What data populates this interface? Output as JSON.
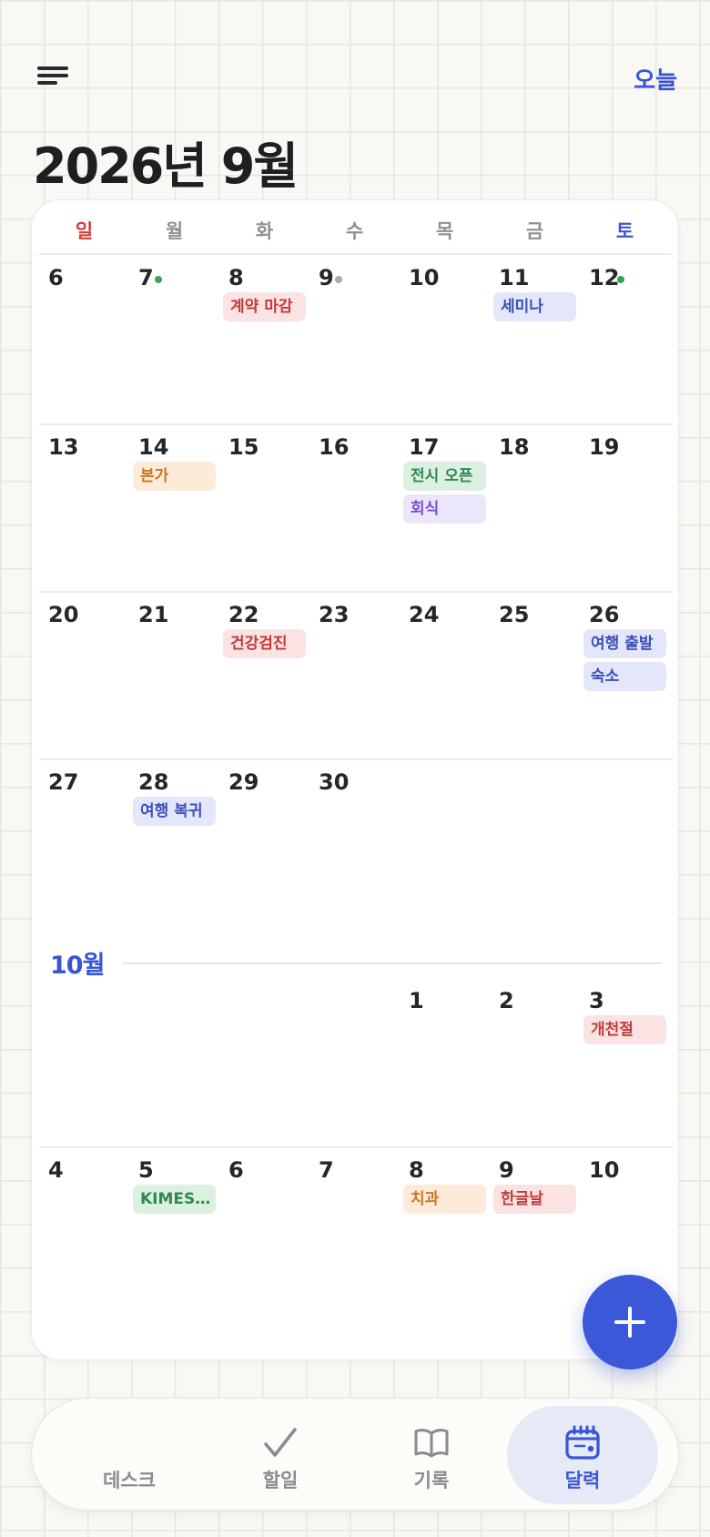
{
  "header": {
    "today_label": "오늘",
    "title": "2026년 9월"
  },
  "weekdays": [
    "일",
    "월",
    "화",
    "수",
    "목",
    "금",
    "토"
  ],
  "september": {
    "weeks": [
      [
        {
          "d": "6"
        },
        {
          "d": "7"
        },
        {
          "d": "8",
          "events": [
            {
              "t": "계약 마감",
              "c": "red"
            }
          ]
        },
        {
          "d": "9"
        },
        {
          "d": "10"
        },
        {
          "d": "11",
          "events": [
            {
              "t": "세미나",
              "c": "blue"
            }
          ]
        },
        {
          "d": "12"
        }
      ],
      [
        {
          "d": "13"
        },
        {
          "d": "14",
          "events": [
            {
              "t": "본가",
              "c": "orange"
            }
          ]
        },
        {
          "d": "15"
        },
        {
          "d": "16"
        },
        {
          "d": "17",
          "events": [
            {
              "t": "전시 오픈",
              "c": "green"
            },
            {
              "t": "회식",
              "c": "purple"
            }
          ]
        },
        {
          "d": "18"
        },
        {
          "d": "19"
        }
      ],
      [
        {
          "d": "20"
        },
        {
          "d": "21"
        },
        {
          "d": "22",
          "events": [
            {
              "t": "건강검진",
              "c": "red"
            }
          ]
        },
        {
          "d": "23"
        },
        {
          "d": "24"
        },
        {
          "d": "25"
        },
        {
          "d": "26",
          "events": [
            {
              "t": "여행 출발",
              "c": "blue"
            },
            {
              "t": "숙소",
              "c": "blue"
            }
          ]
        }
      ],
      [
        {
          "d": "27"
        },
        {
          "d": "28",
          "events": [
            {
              "t": "여행 복귀",
              "c": "blue"
            }
          ]
        },
        {
          "d": "29"
        },
        {
          "d": "30"
        },
        {
          "d": ""
        },
        {
          "d": ""
        },
        {
          "d": ""
        }
      ]
    ]
  },
  "october": {
    "label": "10월",
    "weeks": [
      [
        {
          "d": ""
        },
        {
          "d": ""
        },
        {
          "d": ""
        },
        {
          "d": ""
        },
        {
          "d": "1"
        },
        {
          "d": "2"
        },
        {
          "d": "3",
          "events": [
            {
              "t": "개천절",
              "c": "red"
            }
          ]
        }
      ],
      [
        {
          "d": "4"
        },
        {
          "d": "5",
          "events": [
            {
              "t": "KIMES…",
              "c": "green"
            }
          ]
        },
        {
          "d": "6"
        },
        {
          "d": "7"
        },
        {
          "d": "8",
          "events": [
            {
              "t": "치과",
              "c": "orange"
            }
          ]
        },
        {
          "d": "9",
          "events": [
            {
              "t": "한글날",
              "c": "red"
            }
          ]
        },
        {
          "d": "10"
        }
      ]
    ]
  },
  "tabs": [
    {
      "label": "데스크",
      "icon": "desk-icon"
    },
    {
      "label": "할일",
      "icon": "check-icon"
    },
    {
      "label": "기록",
      "icon": "book-icon"
    },
    {
      "label": "달력",
      "icon": "calendar-icon",
      "active": true
    }
  ],
  "colors": {
    "accent": "#3a55d4",
    "sunday": "#d23a3a",
    "saturday": "#3a55d4"
  }
}
